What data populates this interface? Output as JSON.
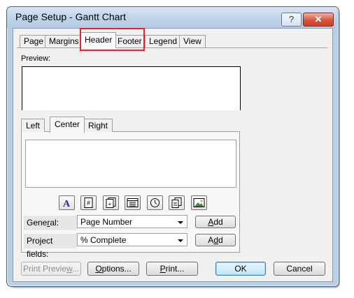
{
  "window": {
    "title": "Page Setup - Gantt Chart",
    "help_glyph": "?",
    "close_glyph": "✕"
  },
  "tabs": [
    {
      "label": "Page"
    },
    {
      "label": "Margins"
    },
    {
      "label": "Header"
    },
    {
      "label": "Footer"
    },
    {
      "label": "Legend"
    },
    {
      "label": "View"
    }
  ],
  "active_tab": "Header",
  "preview": {
    "label": "Preview:"
  },
  "alignment_tabs": [
    {
      "label": "Left"
    },
    {
      "label": "Center"
    },
    {
      "label": "Right"
    }
  ],
  "active_alignment_tab": "Center",
  "header_text": "",
  "insert_buttons": [
    {
      "icon": "format-text-font-icon"
    },
    {
      "icon": "insert-page-number-icon"
    },
    {
      "icon": "insert-total-page-count-icon"
    },
    {
      "icon": "insert-current-date-icon"
    },
    {
      "icon": "insert-current-time-icon"
    },
    {
      "icon": "insert-file-name-icon"
    },
    {
      "icon": "insert-picture-icon"
    }
  ],
  "general": {
    "label_pre": "Gene",
    "label_mn": "r",
    "label_post": "al:",
    "value": "Page Number",
    "add_pre": "",
    "add_mn": "A",
    "add_post": "dd"
  },
  "project_fields": {
    "label": "Project fields:",
    "value": "% Complete",
    "add_pre": "A",
    "add_mn": "d",
    "add_post": "d"
  },
  "buttons": {
    "print_preview": {
      "pre": "Print Previe",
      "mn": "w",
      "post": "..."
    },
    "options": {
      "pre": "",
      "mn": "O",
      "post": "ptions..."
    },
    "print": {
      "pre": "",
      "mn": "P",
      "post": "rint..."
    },
    "ok": "OK",
    "cancel": "Cancel"
  },
  "colors": {
    "highlight_border": "#e0262b",
    "close_button": "#c4422a",
    "default_button": "#3c7fb1"
  }
}
